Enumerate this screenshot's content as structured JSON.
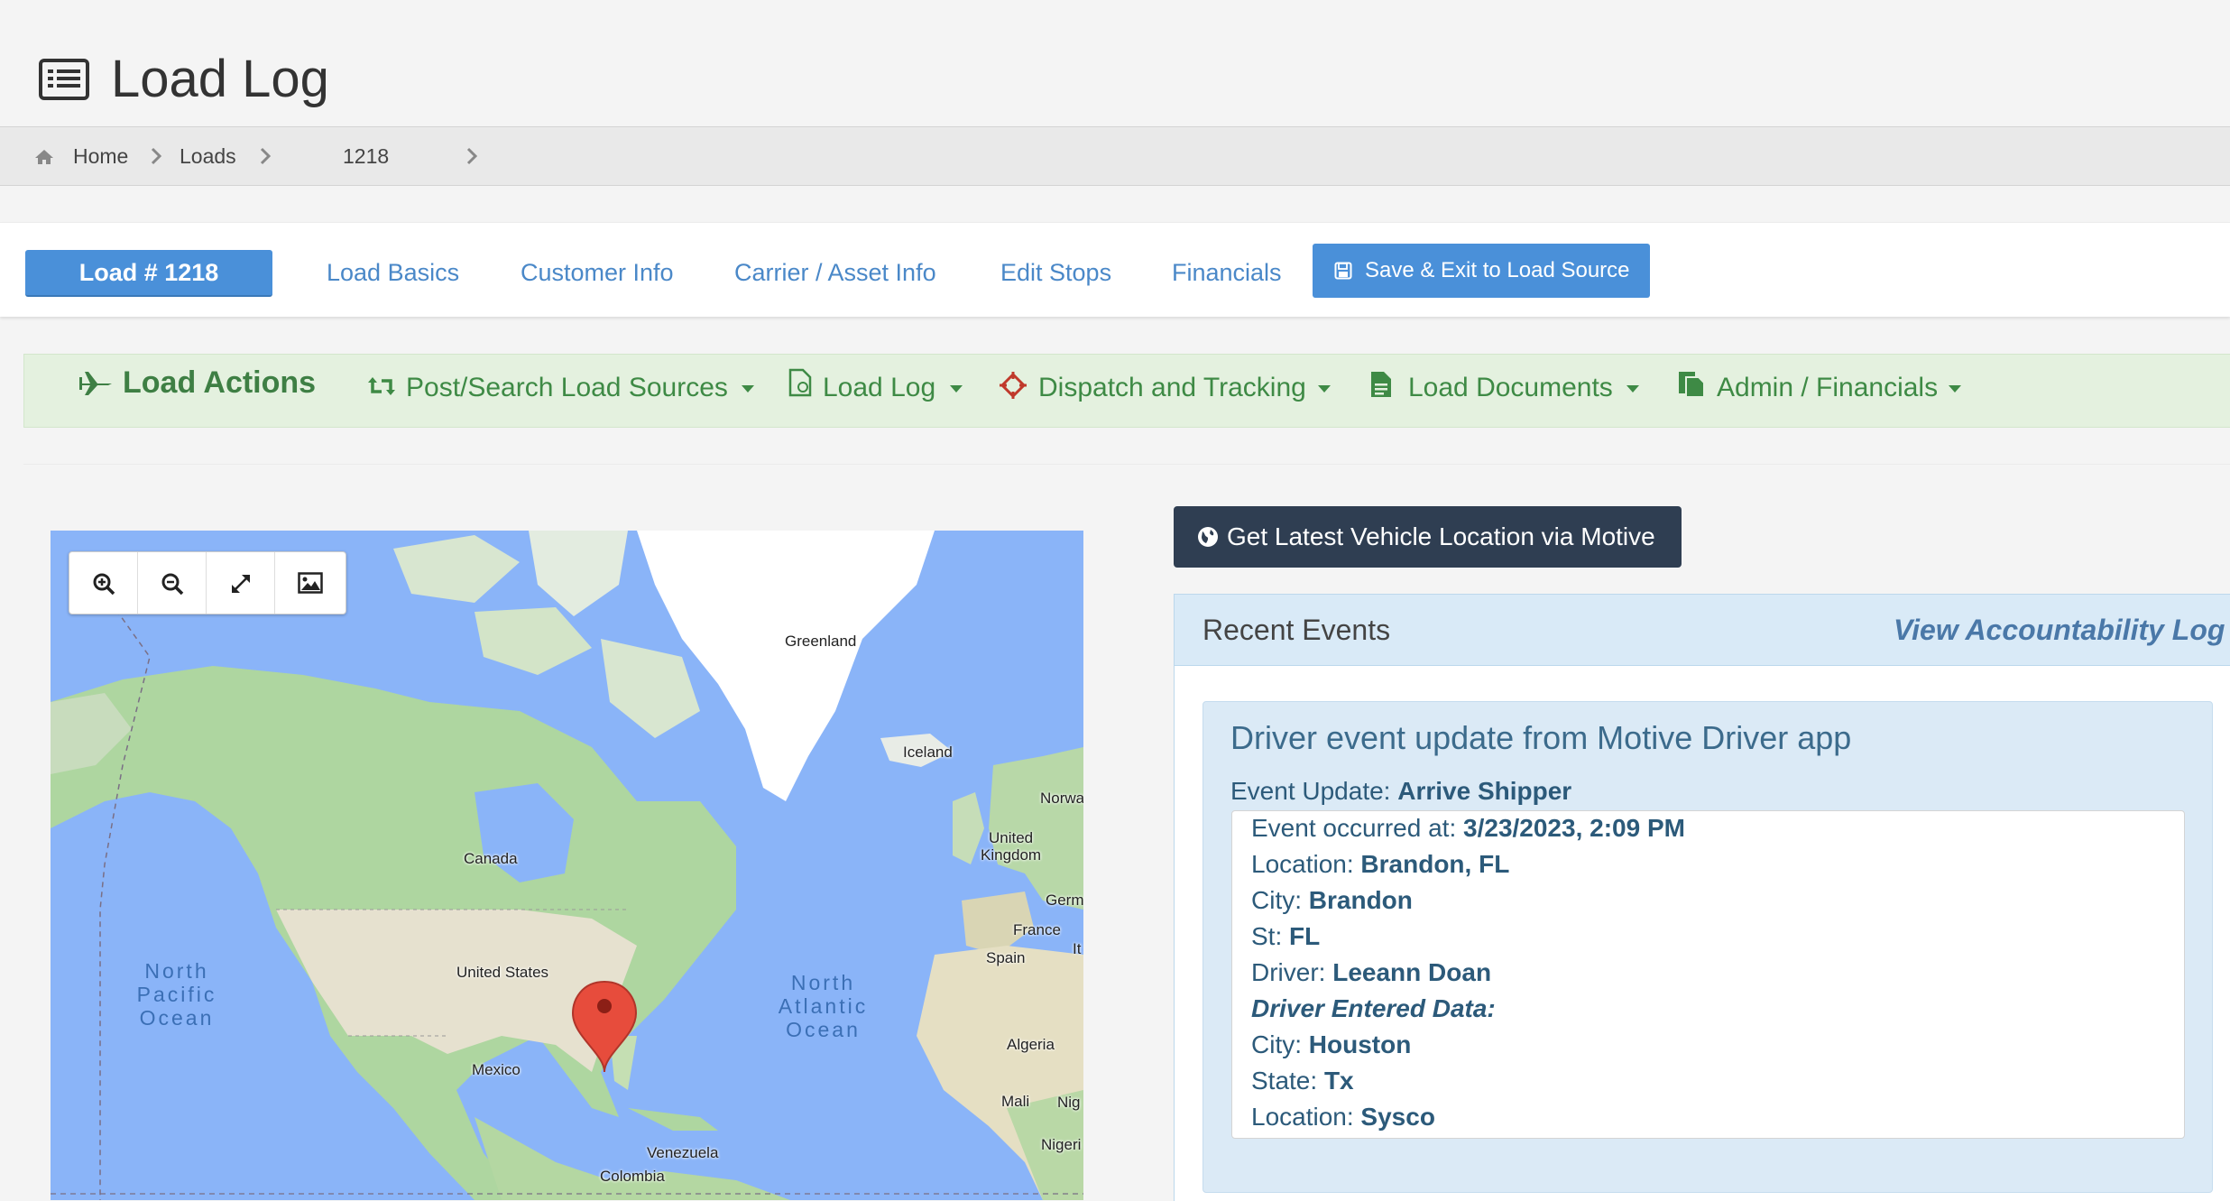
{
  "page": {
    "title": "Load Log"
  },
  "breadcrumb": {
    "home": "Home",
    "loads": "Loads",
    "current": "1218"
  },
  "tabs": {
    "load_number": "Load # 1218",
    "items": [
      "Load Basics",
      "Customer Info",
      "Carrier / Asset Info",
      "Edit Stops",
      "Financials"
    ],
    "save_exit": "Save & Exit to Load Source"
  },
  "actions": {
    "title": "Load Actions",
    "items": [
      "Post/Search Load Sources",
      "Load Log",
      "Dispatch and Tracking",
      "Load Documents",
      "Admin / Financials"
    ]
  },
  "map": {
    "labels": {
      "greenland": "Greenland",
      "iceland": "Iceland",
      "norway": "Norwa",
      "uk_line1": "United",
      "uk_line2": "Kingdom",
      "germany": "Germ",
      "france": "France",
      "italy": "It",
      "spain": "Spain",
      "canada": "Canada",
      "us": "United States",
      "mexico": "Mexico",
      "algeria": "Algeria",
      "mali": "Mali",
      "niger_partial": "Nig",
      "nigeria_partial": "Nigeri",
      "venezuela": "Venezuela",
      "colombia": "Colombia"
    },
    "oceans": {
      "north_pacific": [
        "North",
        "Pacific",
        "Ocean"
      ],
      "north_atlantic": [
        "North",
        "Atlantic",
        "Ocean"
      ]
    },
    "controls": [
      "zoom-in",
      "zoom-out",
      "fullscreen",
      "image"
    ]
  },
  "motive": {
    "button": "Get Latest Vehicle Location via Motive"
  },
  "events": {
    "title": "Recent Events",
    "accountability_link": "View Accountability Log",
    "card": {
      "title": "Driver event update from Motive Driver app",
      "update_label": "Event Update: ",
      "update_value": "Arrive Shipper",
      "details": {
        "occurred_label": "Event occurred at: ",
        "occurred_value": "3/23/2023, 2:09 PM",
        "location_label": "Location: ",
        "location_value": "Brandon, FL",
        "city_label": "City: ",
        "city_value": "Brandon",
        "st_label": "St: ",
        "st_value": "FL",
        "driver_label": "Driver: ",
        "driver_value": "Leeann Doan",
        "driver_entered": "Driver Entered Data:",
        "de_city_label": "City: ",
        "de_city_value": "Houston",
        "de_state_label": "State: ",
        "de_state_value": "Tx",
        "de_location_label": "Location: ",
        "de_location_value": "Sysco"
      }
    }
  },
  "colors": {
    "primary_blue": "#4a90d9",
    "action_green": "#3e8a45",
    "action_bg": "#e4f1df",
    "dark_button": "#2f3e52",
    "event_card_bg": "#dbeaf6",
    "map_ocean": "#8ab4f8",
    "map_land": "#aed6a0",
    "marker_red": "#e74c3c"
  }
}
